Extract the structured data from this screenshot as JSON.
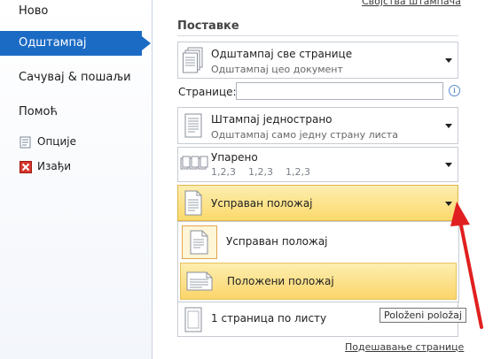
{
  "nav": {
    "items": [
      {
        "label": "Ново"
      },
      {
        "label": "Одштампај"
      },
      {
        "label": "Сачувај & пошаљи"
      },
      {
        "label": "Помоћ"
      }
    ],
    "small": [
      {
        "label": "Опције",
        "icon": "options-icon"
      },
      {
        "label": "Изађи",
        "icon": "exit-icon"
      }
    ]
  },
  "panel": {
    "printer_properties_link": "Својства штампача",
    "settings_title": "Поставке",
    "print_all": {
      "title": "Одштампај све странице",
      "subtitle": "Одштампај цео документ"
    },
    "pages_label": "Странице:",
    "pages_value": "",
    "one_sided": {
      "title": "Штампај једнострано",
      "subtitle": "Одштампај само једну страну листа"
    },
    "collated": {
      "title": "Упарено",
      "subtitle": "1,2,3    1,2,3    1,2,3"
    },
    "orientation": {
      "title": "Усправан положај"
    },
    "orientation_options": [
      {
        "label": "Усправан положај"
      },
      {
        "label": "Положени положај"
      }
    ],
    "pages_per_sheet": "1 страница по листу",
    "tooltip": "Položeni položaj",
    "page_setup_link": "Подешавање странице"
  },
  "colors": {
    "nav_selected": "#1b6bc4",
    "highlight": "#fbd96b",
    "arrow": "#e02020"
  }
}
